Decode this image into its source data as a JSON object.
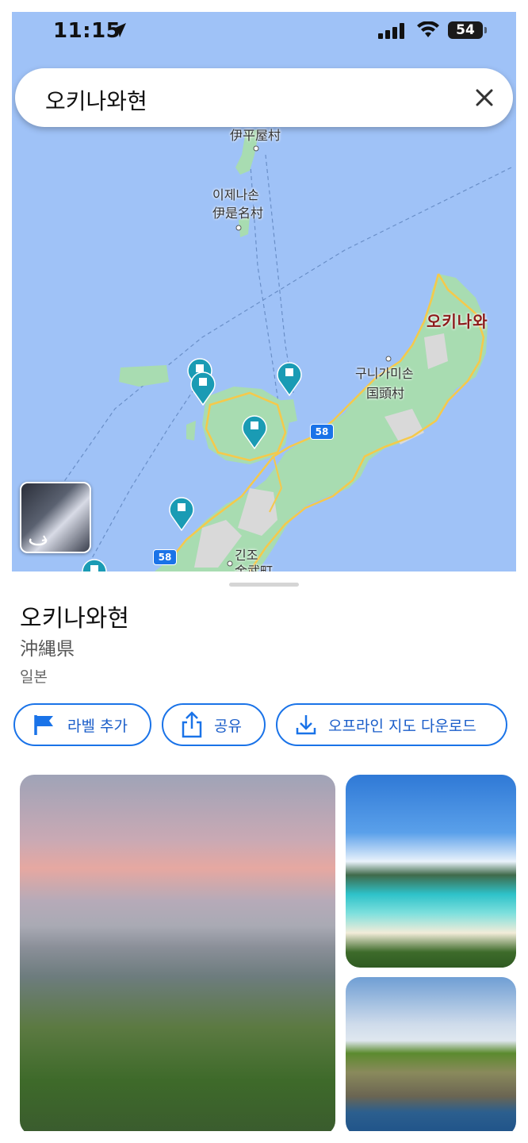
{
  "status_bar": {
    "time": "11:15",
    "battery": "54"
  },
  "search": {
    "query": "오키나와현"
  },
  "map": {
    "labels": {
      "iheya": "伊平屋村",
      "izena_ko": "이제나손",
      "izena_ja": "伊是名村",
      "okinawa_pref": "오키나와",
      "kunigami_ko": "구니가미손",
      "kunigami_ja": "国頭村",
      "kin_ko": "긴조",
      "kin_ja": "金武町"
    },
    "route_shields": [
      "58",
      "58"
    ]
  },
  "place": {
    "title": "오키나와현",
    "subtitle": "沖縄県",
    "country": "일본"
  },
  "actions": {
    "label": "라벨 추가",
    "share": "공유",
    "offline": "오프라인 지도 다운로드"
  },
  "colors": {
    "water": "#9fc2f7",
    "land": "#a8dcb1",
    "road": "#f5c94b",
    "pin": "#1a9bb4",
    "accent": "#1a73e8"
  }
}
